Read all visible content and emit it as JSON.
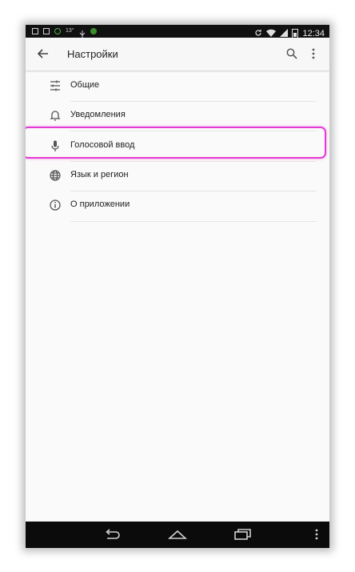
{
  "status_bar": {
    "time": "12:34",
    "notification_text": "13°",
    "icons": [
      "image-icon",
      "mail-icon",
      "circle-icon",
      "usb-icon",
      "green-app-icon",
      "sync-icon",
      "wifi-icon",
      "signal-icon",
      "battery-icon"
    ]
  },
  "app_bar": {
    "title": "Настройки",
    "icons": [
      "back-arrow-icon",
      "search-icon",
      "more-vert-icon"
    ]
  },
  "settings_list": {
    "items": [
      {
        "label": "Общие",
        "icon": "tune-icon"
      },
      {
        "label": "Уведомления",
        "icon": "bell-icon"
      },
      {
        "label": "Голосовой ввод",
        "icon": "mic-icon",
        "highlighted": true
      },
      {
        "label": "Язык и регион",
        "icon": "globe-icon"
      },
      {
        "label": "О приложении",
        "icon": "info-icon"
      }
    ]
  },
  "nav_bar": {
    "icons": [
      "nav-back-icon",
      "nav-home-icon",
      "nav-recents-icon",
      "nav-menu-icon"
    ]
  },
  "colors": {
    "highlight": "#e63ad6",
    "app_background": "#fafafa",
    "system_bars": "#0b0b0b"
  }
}
